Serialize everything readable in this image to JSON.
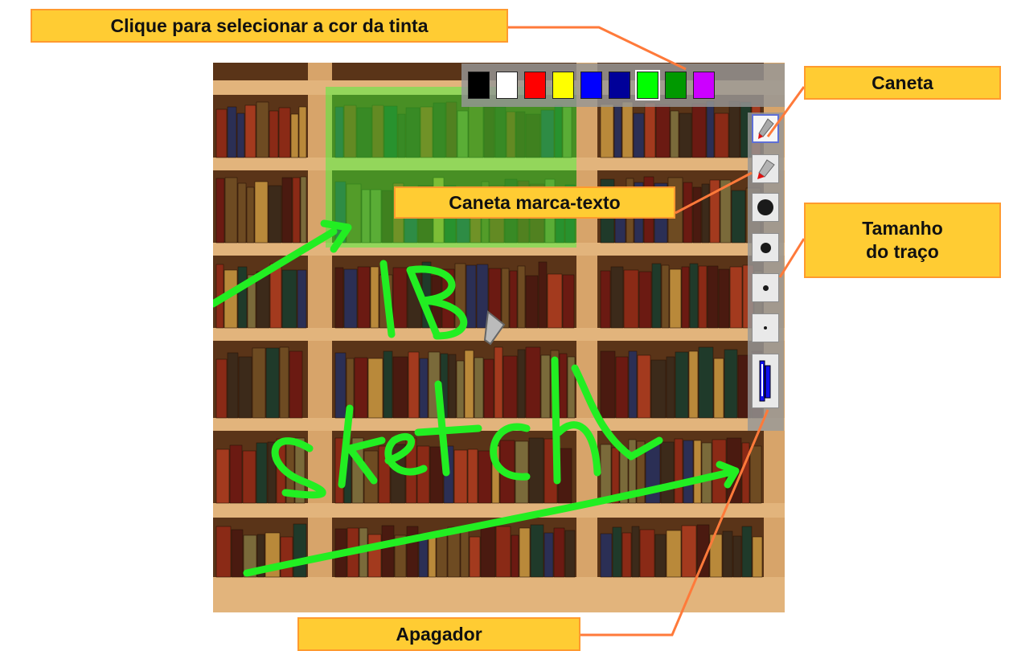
{
  "callouts": {
    "ink_color": "Clique para selecionar a cor da tinta",
    "pen": "Caneta",
    "highlighter": "Caneta marca-texto",
    "stroke_size_line1": "Tamanho",
    "stroke_size_line2": "do traço",
    "eraser": "Apagador"
  },
  "palette": {
    "colors": [
      "#000000",
      "#ffffff",
      "#ff0000",
      "#ffff00",
      "#0000ff",
      "#000099",
      "#00ff00",
      "#009900",
      "#cc00ff"
    ],
    "selected": "#00ff00"
  },
  "toolbar": {
    "tools": [
      "pen-tool",
      "highlighter-tool",
      "stroke-size-large",
      "stroke-size-medium",
      "stroke-size-small",
      "stroke-size-tiny",
      "eraser-tool"
    ],
    "selected": "pen-tool"
  },
  "canvas": {
    "handwriting": [
      "IB",
      "SKETCH"
    ],
    "ink_color": "#22ee22"
  },
  "colors": {
    "callout_fill": "#ffcc33",
    "callout_border": "#ff9a2e",
    "leader_line": "#ff7a3a"
  }
}
